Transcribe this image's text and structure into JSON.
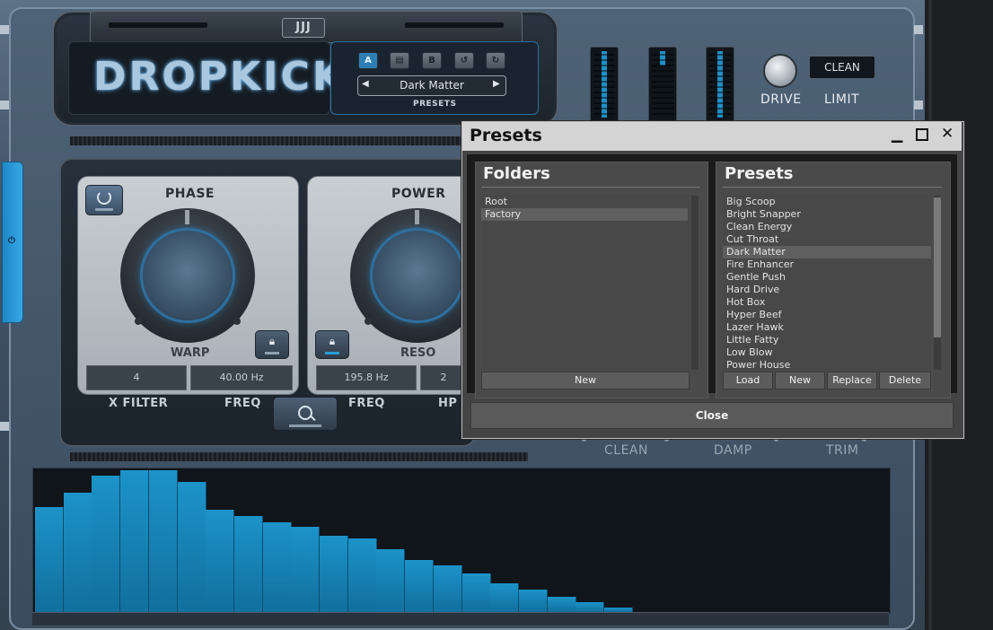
{
  "header": {
    "brand": "DROPKICK",
    "logo_badge": "JJJ",
    "ab_buttons": [
      "A",
      "B"
    ],
    "preset_name": "Dark Matter",
    "presets_caption": "PRESETS"
  },
  "controls": {
    "drive_label": "DRIVE",
    "limit_label": "LIMIT",
    "clean_display": "CLEAN"
  },
  "modules": {
    "phase": {
      "title": "PHASE",
      "sub_label": "WARP",
      "value_1": "4",
      "value_2": "40.00 Hz"
    },
    "power": {
      "title": "POWER",
      "sub_label": "RESO",
      "value_1": "195.8 Hz",
      "value_2": "2"
    }
  },
  "bottom_labels": {
    "x_filter": "X FILTER",
    "freq_1": "FREQ",
    "freq_2": "FREQ",
    "hp": "HP",
    "clean": "CLEAN",
    "damp": "DAMP",
    "trim": "TRIM"
  },
  "spectrum": {
    "levels": [
      0.74,
      0.84,
      0.96,
      1.0,
      1.0,
      0.92,
      0.72,
      0.68,
      0.63,
      0.6,
      0.54,
      0.52,
      0.44,
      0.37,
      0.33,
      0.27,
      0.2,
      0.16,
      0.11,
      0.07,
      0.03
    ],
    "bar_color": "#1c93c9"
  },
  "dialog": {
    "title": "Presets",
    "folders_title": "Folders",
    "presets_title": "Presets",
    "folders": [
      "Root",
      "Factory"
    ],
    "selected_folder": "Factory",
    "presets": [
      "Big Scoop",
      "Bright Snapper",
      "Clean Energy",
      "Cut Throat",
      "Dark Matter",
      "Fire Enhancer",
      "Gentle Push",
      "Hard Drive",
      "Hot Box",
      "Hyper Beef",
      "Lazer Hawk",
      "Little Fatty",
      "Low Blow",
      "Power House"
    ],
    "selected_preset": "Dark Matter",
    "new_folder_button": "New",
    "load_button": "Load",
    "new_preset_button": "New",
    "replace_button": "Replace",
    "delete_button": "Delete",
    "close_button": "Close",
    "minimize_icon": "minimize-icon",
    "maximize_icon": "maximize-icon",
    "close_icon": "close-icon"
  },
  "colors": {
    "accent": "#1f8fc4",
    "dialog_bg": "#444444",
    "titlebar": "#d4d4d4"
  }
}
